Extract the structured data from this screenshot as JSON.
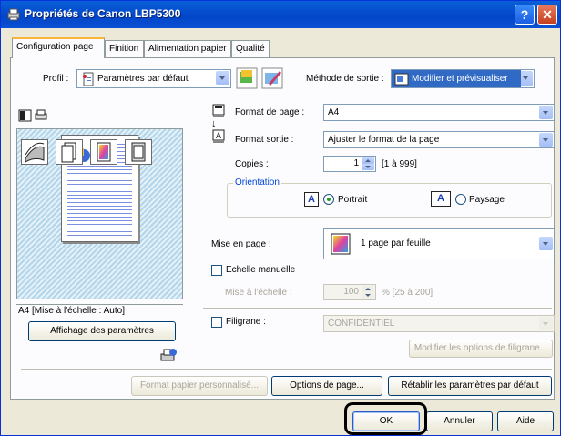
{
  "window": {
    "title": "Propriétés de Canon LBP5300",
    "help_label": "?",
    "close_label": "✕"
  },
  "tabs": [
    {
      "label": "Configuration page",
      "active": true
    },
    {
      "label": "Finition",
      "active": false
    },
    {
      "label": "Alimentation papier",
      "active": false
    },
    {
      "label": "Qualité",
      "active": false
    }
  ],
  "profile": {
    "label": "Profil :",
    "value": "Paramètres par défaut"
  },
  "output_method": {
    "label": "Méthode de sortie :",
    "value": "Modifier et prévisualiser"
  },
  "page_format": {
    "label": "Format de page :",
    "value": "A4"
  },
  "output_format": {
    "label": "Format sortie :",
    "value": "Ajuster le format de la page"
  },
  "copies": {
    "label": "Copies :",
    "value": "1",
    "range": "[1 à 999]"
  },
  "orientation": {
    "title": "Orientation",
    "portrait_label": "Portrait",
    "landscape_label": "Paysage",
    "portrait_icon_letter": "A",
    "landscape_icon_letter": "A",
    "selected": "portrait"
  },
  "layout": {
    "label": "Mise en page :",
    "value": "1 page par feuille"
  },
  "manual_scaling": {
    "label": "Echelle manuelle",
    "checked": false
  },
  "scaling": {
    "label": "Mise à l'échelle :",
    "value": "100",
    "range": "% [25 à 200]"
  },
  "watermark": {
    "label": "Filigrane :",
    "checked": false,
    "value": "CONFIDENTIEL",
    "edit_button": "Modifier les options de filigrane..."
  },
  "preview": {
    "status": "A4 [Mise à l'échelle : Auto]",
    "show_settings_button": "Affichage des paramètres"
  },
  "bottom_buttons": {
    "custom_paper": "Format papier personnalisé...",
    "page_options": "Options de page...",
    "restore_defaults": "Rétablir les paramètres par défaut"
  },
  "dialog_buttons": {
    "ok": "OK",
    "cancel": "Annuler",
    "help": "Aide"
  },
  "colors": {
    "title_bar": "#0245c8",
    "tab_highlight": "#f8b53a",
    "group_title": "#0046d5",
    "disabled_text": "#a9a69a"
  }
}
